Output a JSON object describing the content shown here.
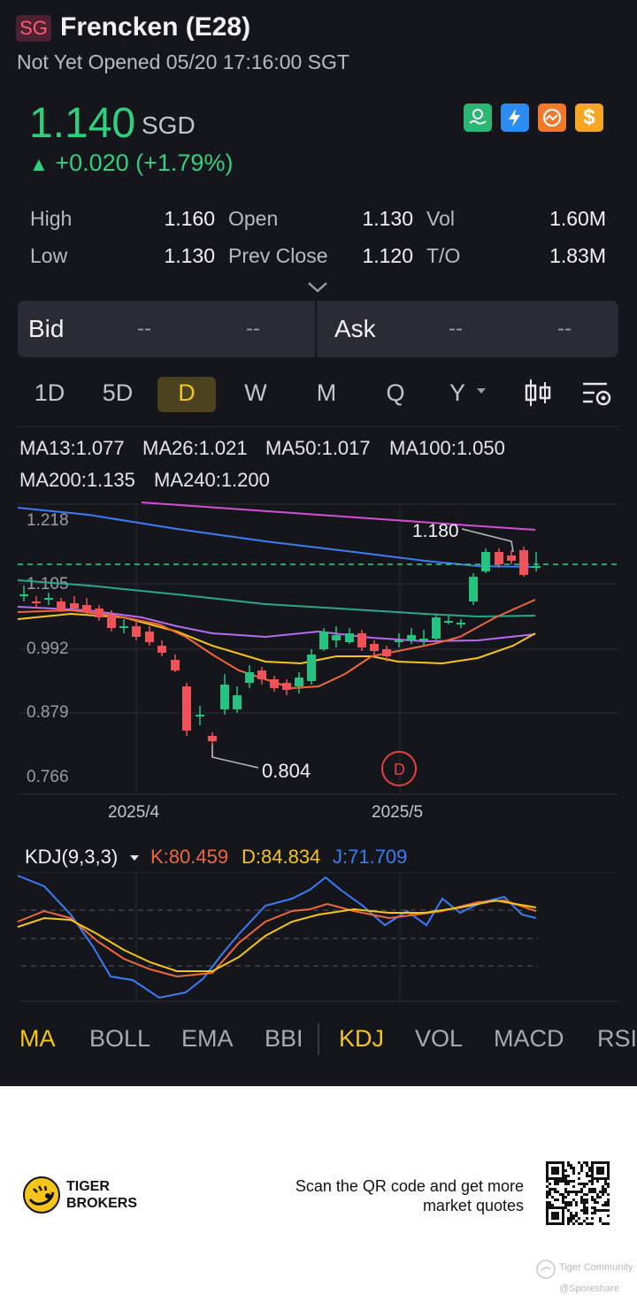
{
  "header": {
    "market": "SG",
    "name": "Frencken (E28)",
    "status": "Not Yet Opened 05/20 17:16:00 SGT",
    "price": "1.140",
    "currency": "SGD",
    "change": "+0.020 (+1.79%)",
    "up_arrow": "▲",
    "badges": [
      {
        "icon": "hand-coin-icon",
        "color": "#2bb673"
      },
      {
        "icon": "lightning-icon",
        "color": "#2d8cf0"
      },
      {
        "icon": "swap-chart-icon",
        "color": "#f07a2a"
      },
      {
        "icon": "dollar-icon",
        "color": "#f5a623"
      }
    ]
  },
  "stats": {
    "high_label": "High",
    "high": "1.160",
    "open_label": "Open",
    "open": "1.130",
    "vol_label": "Vol",
    "vol": "1.60M",
    "low_label": "Low",
    "low": "1.130",
    "prev_label": "Prev Close",
    "prev": "1.120",
    "to_label": "T/O",
    "to": "1.83M"
  },
  "bidask": {
    "bid": "Bid",
    "bid_v1": "--",
    "bid_v2": "--",
    "ask": "Ask",
    "ask_v1": "--",
    "ask_v2": "--"
  },
  "timeframes": [
    "1D",
    "5D",
    "D",
    "W",
    "M",
    "Q",
    "Y"
  ],
  "active_timeframe": "D",
  "ma_legend": [
    {
      "text": "MA13:1.077",
      "color": "#f0683a"
    },
    {
      "text": "MA26:1.021",
      "color": "#f5c518"
    },
    {
      "text": "MA50:1.017",
      "color": "#b56cf0"
    },
    {
      "text": "MA100:1.050",
      "color": "#2aa889"
    },
    {
      "text": "MA200:1.135",
      "color": "#3d7cf5"
    },
    {
      "text": "MA240:1.200",
      "color": "#d84cd8"
    }
  ],
  "chart": {
    "y_ticks": [
      "1.218",
      "1.105",
      "0.992",
      "0.879",
      "0.766"
    ],
    "x_ticks": [
      "2025/4",
      "2025/5"
    ],
    "high_marker": "1.180",
    "low_marker": "0.804",
    "dividend_marker": "D",
    "up_color": "#26c281",
    "down_color": "#f0525a"
  },
  "kdj": {
    "name": "KDJ(9,3,3)",
    "k": "K:80.459",
    "d": "D:84.834",
    "j": "J:71.709",
    "k_color": "#f0683a",
    "d_color": "#f5c518",
    "j_color": "#3d7cf5"
  },
  "indicators": {
    "main": [
      "MA",
      "BOLL",
      "EMA",
      "BBI"
    ],
    "sub": [
      "KDJ",
      "VOL",
      "MACD",
      "RSI"
    ],
    "active_main": "MA",
    "active_sub": "KDJ"
  },
  "footer": {
    "brand_line1": "TIGER",
    "brand_line2": "BROKERS",
    "scan_line1": "Scan the QR code and get more",
    "scan_line2": "market quotes",
    "wm1": "Tiger Community",
    "wm2": "@Sporeshare"
  }
}
